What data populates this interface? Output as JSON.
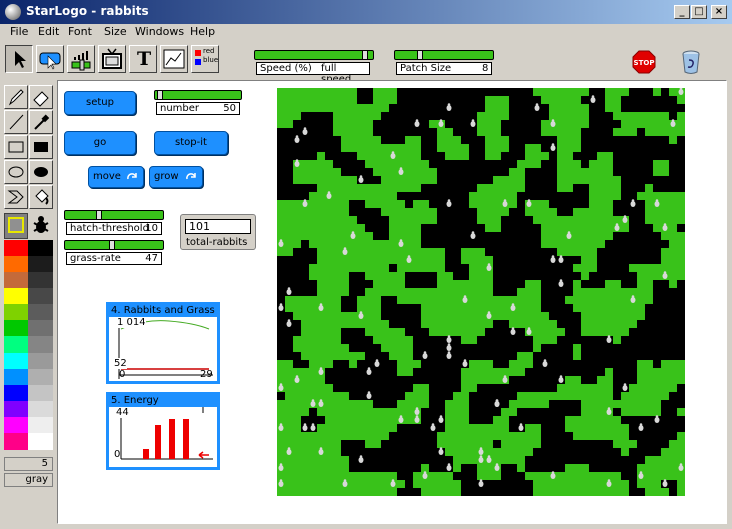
{
  "window": {
    "title": "StarLogo - rabbits"
  },
  "menu": [
    "File",
    "Edit",
    "Font",
    "Size",
    "Windows",
    "Help"
  ],
  "toolbar": {
    "speed_label": "Speed (%)",
    "speed_value": "full speed",
    "patch_size_label": "Patch Size",
    "patch_size_value": "8",
    "stop_label": "STOP",
    "swatch_red": "red",
    "swatch_blue": "blue",
    "text_tool": "T"
  },
  "interface": {
    "setup": "setup",
    "go": "go",
    "stop_it": "stop-it",
    "move": "move",
    "grow": "grow",
    "number_label": "number",
    "number_value": "50",
    "hatch_label": "hatch-threshold",
    "hatch_value": "10",
    "grass_label": "grass-rate",
    "grass_value": "47",
    "rabbits_value": "101",
    "rabbits_label": "total-rabbits"
  },
  "plot1": {
    "title": "4. Rabbits and Grass",
    "ymax": "1 014",
    "ymid": "52",
    "xmin": "0",
    "xmax": "29"
  },
  "plot2": {
    "title": "5. Energy",
    "ymax": "44",
    "ymin": "0"
  },
  "palette": {
    "brush_size": "5",
    "color_name": "gray",
    "colors": [
      "#ff0000",
      "#ff6a00",
      "#c46a3a",
      "#ffff00",
      "#7fd200",
      "#00c800",
      "#00ff80",
      "#00ffff",
      "#0090ff",
      "#0000ff",
      "#8000ff",
      "#ff00ff",
      "#ff0088"
    ],
    "grays": [
      "#000000",
      "#1c1c1c",
      "#333333",
      "#484848",
      "#5c5c5c",
      "#707070",
      "#858585",
      "#9a9a9a",
      "#afafaf",
      "#c4c4c4",
      "#dadada",
      "#eeeeee",
      "#ffffff"
    ]
  },
  "colors": {
    "grass": "#39c21a",
    "soil": "#000000",
    "rabbit": "#d8d8d8",
    "button": "#1e90ff"
  }
}
